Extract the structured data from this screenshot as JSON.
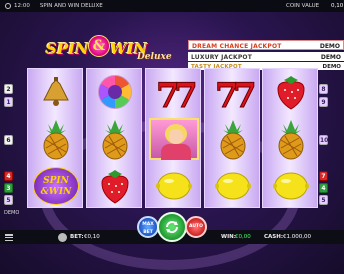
{
  "topbar": {
    "time": "12:00",
    "game_title": "SPIN AND WIN DELUXE",
    "coin_value_label": "COIN VALUE",
    "coin_value": "0,10"
  },
  "logo": {
    "word1": "SPIN",
    "amp": "&",
    "word2": "WIN",
    "sub": "Deluxe"
  },
  "jackpots": [
    {
      "label": "DREAM CHANCE JACKPOT",
      "value": "DEMO"
    },
    {
      "label": "LUXURY JACKPOT",
      "value": "DEMO"
    },
    {
      "label": "TASTY JACKPOT",
      "value": "DEMO"
    }
  ],
  "reels": [
    [
      "bell",
      "pineapple",
      "spinwin"
    ],
    [
      "bonus",
      "pineapple",
      "strawberry"
    ],
    [
      "seven",
      "lady",
      "lemon"
    ],
    [
      "seven",
      "pineapple",
      "lemon"
    ],
    [
      "strawberry",
      "pineapple",
      "lemon"
    ]
  ],
  "line_markers": {
    "left": [
      "2",
      "1",
      "6",
      "4",
      "3",
      "5"
    ],
    "right": [
      "8",
      "9",
      "10",
      "7",
      "4",
      "5"
    ]
  },
  "demo_label": "DEMO",
  "footer": {
    "bet_label": "BET:",
    "bet_value": "€0,10",
    "win_label": "WIN:",
    "win_value": "€0,00",
    "cash_label": "CASH:",
    "cash_value": "€1.000,00"
  },
  "buttons": {
    "maxbet": "MAX BET",
    "auto": "AUTO"
  },
  "colors": {
    "background": "#2a1550",
    "jackpot_red": "#d43e1f",
    "spin_green": "#168a28",
    "auto_red": "#c01818",
    "maxbet_blue": "#1848b8"
  }
}
